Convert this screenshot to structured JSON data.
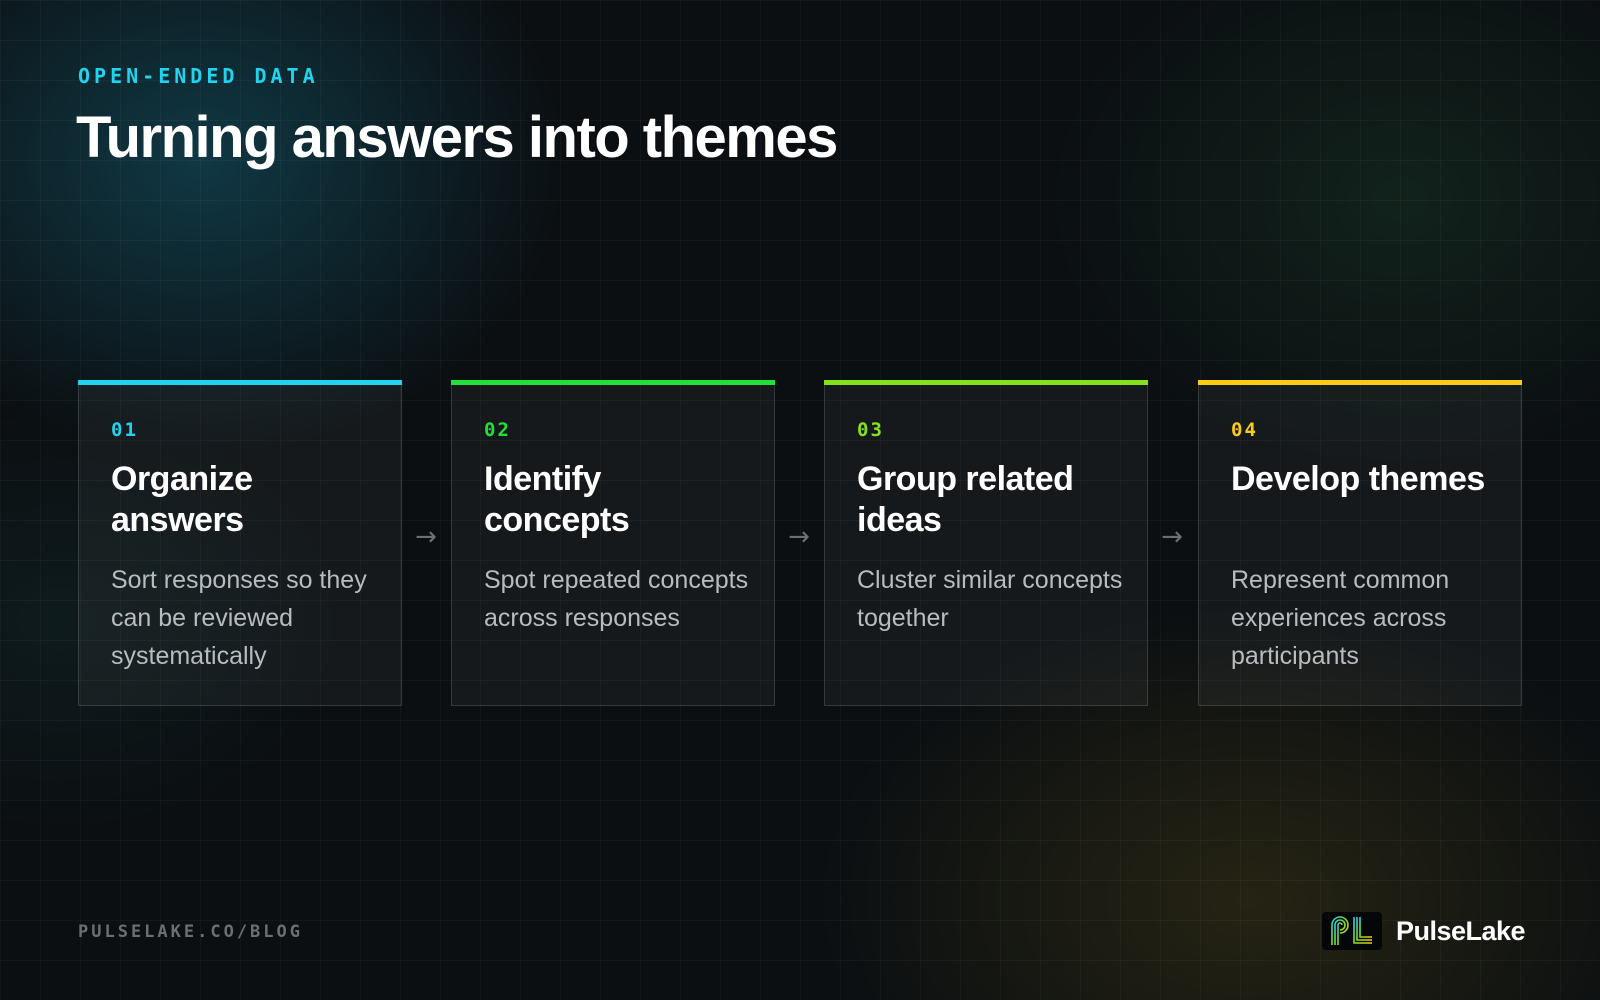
{
  "header": {
    "eyebrow": "OPEN-ENDED DATA",
    "title": "Turning answers into themes"
  },
  "steps": [
    {
      "number": "01",
      "title": "Organize answers",
      "description": "Sort responses so they can be reviewed systematically",
      "color": "#22d3ee"
    },
    {
      "number": "02",
      "title": "Identify concepts",
      "description": "Spot repeated concepts across responses",
      "color": "#22e03a"
    },
    {
      "number": "03",
      "title": "Group related ideas",
      "description": "Cluster similar concepts together",
      "color": "#84e11d"
    },
    {
      "number": "04",
      "title": "Develop themes",
      "description": "Represent common experiences across participants",
      "color": "#facc15"
    }
  ],
  "arrow_glyph": "→",
  "footer": {
    "url": "PULSELAKE.CO/BLOG",
    "brand_name": "PulseLake",
    "logo_icon": "pulselake-logo-icon"
  }
}
